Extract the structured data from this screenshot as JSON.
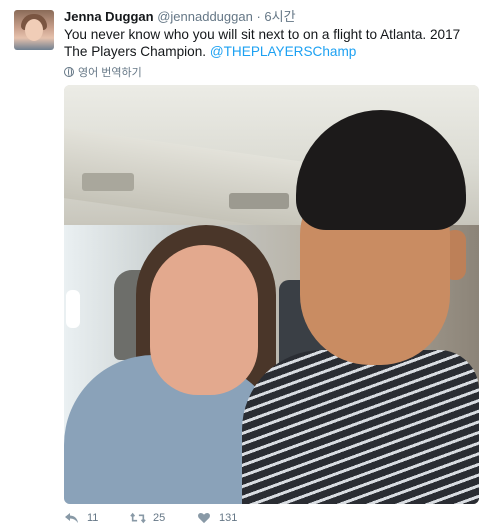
{
  "tweet": {
    "author_name": "Jenna Duggan",
    "handle": "@jennadduggan",
    "separator": "·",
    "time": "6시간",
    "text_before": "You never know who you will sit next to on a flight to Atlanta. 2017 The Players Champion.",
    "mention": "@THEPLAYERSChamp",
    "translate_label": "영어 번역하기"
  },
  "actions": {
    "reply_count": "11",
    "retweet_count": "25",
    "like_count": "131"
  },
  "colors": {
    "link": "#1da1f2",
    "muted": "#657786",
    "text": "#14171a"
  },
  "icons": [
    "reply-icon",
    "retweet-icon",
    "heart-icon",
    "globe-icon"
  ]
}
